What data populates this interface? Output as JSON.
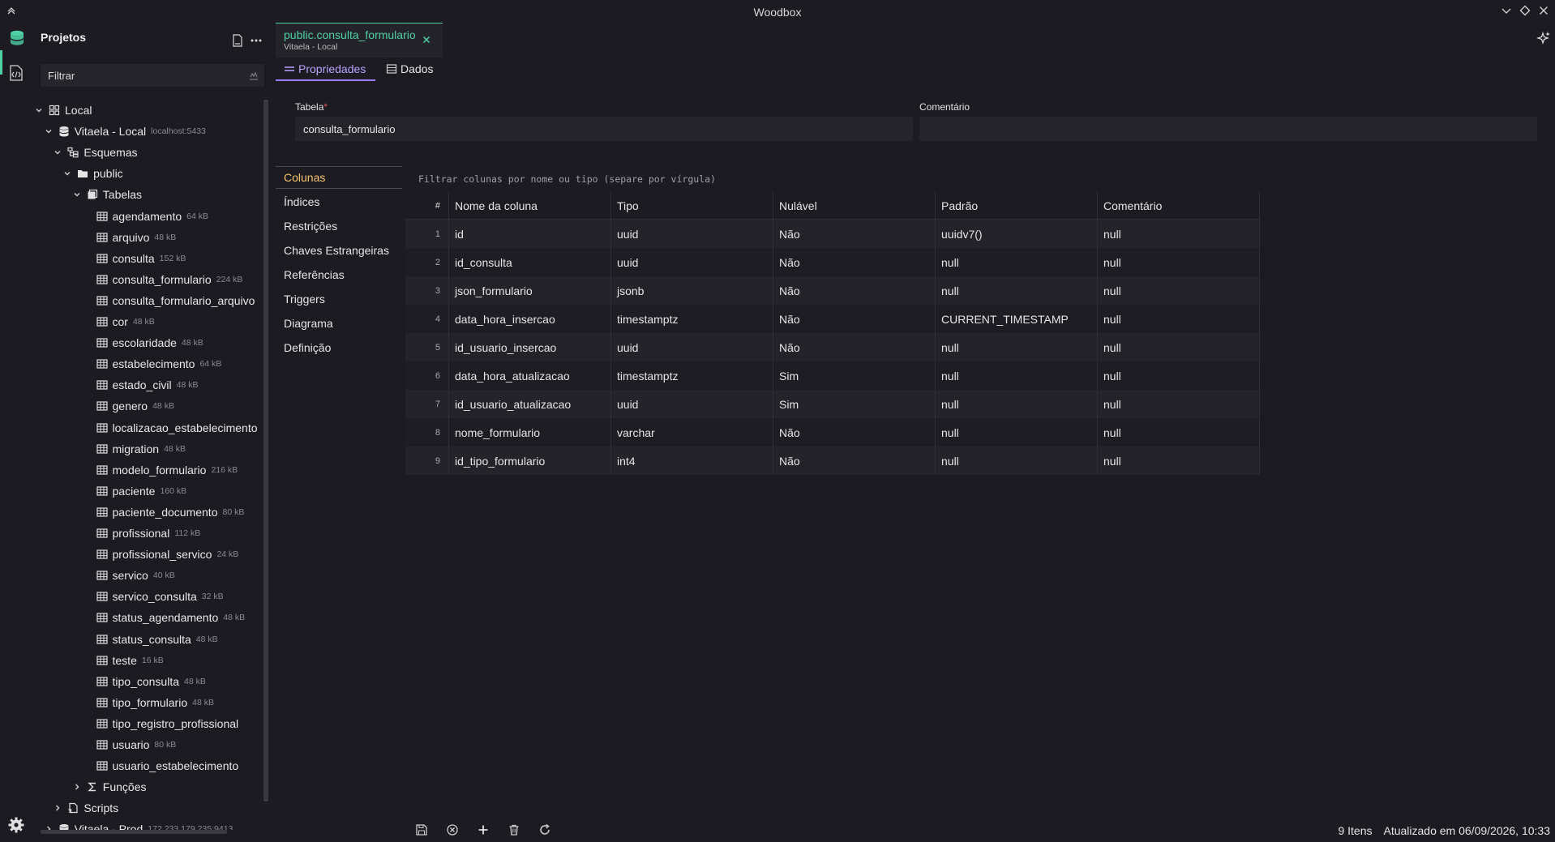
{
  "window": {
    "title": "Woodbox"
  },
  "sidebar": {
    "title": "Projetos",
    "filter_placeholder": "Filtrar",
    "tree": [
      {
        "label": "Local",
        "level": 0,
        "kind": "group",
        "expanded": true
      },
      {
        "label": "Vitaela - Local",
        "size": "localhost:5433",
        "level": 1,
        "kind": "db",
        "expanded": true
      },
      {
        "label": "Esquemas",
        "level": 2,
        "kind": "schemas",
        "expanded": true
      },
      {
        "label": "public",
        "level": 3,
        "kind": "folder",
        "expanded": true
      },
      {
        "label": "Tabelas",
        "level": 4,
        "kind": "tables",
        "expanded": true
      },
      {
        "label": "agendamento",
        "size": "64 kB",
        "level": 5,
        "kind": "table"
      },
      {
        "label": "arquivo",
        "size": "48 kB",
        "level": 5,
        "kind": "table"
      },
      {
        "label": "consulta",
        "size": "152 kB",
        "level": 5,
        "kind": "table"
      },
      {
        "label": "consulta_formulario",
        "size": "224 kB",
        "level": 5,
        "kind": "table"
      },
      {
        "label": "consulta_formulario_arquivo",
        "size": "",
        "level": 5,
        "kind": "table"
      },
      {
        "label": "cor",
        "size": "48 kB",
        "level": 5,
        "kind": "table"
      },
      {
        "label": "escolaridade",
        "size": "48 kB",
        "level": 5,
        "kind": "table"
      },
      {
        "label": "estabelecimento",
        "size": "64 kB",
        "level": 5,
        "kind": "table"
      },
      {
        "label": "estado_civil",
        "size": "48 kB",
        "level": 5,
        "kind": "table"
      },
      {
        "label": "genero",
        "size": "48 kB",
        "level": 5,
        "kind": "table"
      },
      {
        "label": "localizacao_estabelecimento",
        "size": "",
        "level": 5,
        "kind": "table"
      },
      {
        "label": "migration",
        "size": "48 kB",
        "level": 5,
        "kind": "table"
      },
      {
        "label": "modelo_formulario",
        "size": "216 kB",
        "level": 5,
        "kind": "table"
      },
      {
        "label": "paciente",
        "size": "160 kB",
        "level": 5,
        "kind": "table"
      },
      {
        "label": "paciente_documento",
        "size": "80 kB",
        "level": 5,
        "kind": "table"
      },
      {
        "label": "profissional",
        "size": "112 kB",
        "level": 5,
        "kind": "table"
      },
      {
        "label": "profissional_servico",
        "size": "24 kB",
        "level": 5,
        "kind": "table"
      },
      {
        "label": "servico",
        "size": "40 kB",
        "level": 5,
        "kind": "table"
      },
      {
        "label": "servico_consulta",
        "size": "32 kB",
        "level": 5,
        "kind": "table"
      },
      {
        "label": "status_agendamento",
        "size": "48 kB",
        "level": 5,
        "kind": "table"
      },
      {
        "label": "status_consulta",
        "size": "48 kB",
        "level": 5,
        "kind": "table"
      },
      {
        "label": "teste",
        "size": "16 kB",
        "level": 5,
        "kind": "table"
      },
      {
        "label": "tipo_consulta",
        "size": "48 kB",
        "level": 5,
        "kind": "table"
      },
      {
        "label": "tipo_formulario",
        "size": "48 kB",
        "level": 5,
        "kind": "table"
      },
      {
        "label": "tipo_registro_profissional",
        "size": "",
        "level": 5,
        "kind": "table"
      },
      {
        "label": "usuario",
        "size": "80 kB",
        "level": 5,
        "kind": "table"
      },
      {
        "label": "usuario_estabelecimento",
        "size": "",
        "level": 5,
        "kind": "table"
      },
      {
        "label": "Funções",
        "level": 4,
        "kind": "functions",
        "expanded": false
      },
      {
        "label": "Scripts",
        "level": 2,
        "kind": "scripts",
        "expanded": false
      },
      {
        "label": "Vitaela - Prod",
        "size": "172.233.179.235:9413",
        "level": 1,
        "kind": "db",
        "expanded": false
      }
    ]
  },
  "editor": {
    "tab": {
      "title": "public.consulta_formulario",
      "subtitle": "Vitaela - Local"
    },
    "subtabs": {
      "properties": "Propriedades",
      "data": "Dados"
    },
    "form": {
      "table_label": "Tabela",
      "required_mark": "*",
      "table_value": "consulta_formulario",
      "comment_label": "Comentário",
      "comment_value": ""
    },
    "nav": [
      "Colunas",
      "Índices",
      "Restrições",
      "Chaves Estrangeiras",
      "Referências",
      "Triggers",
      "Diagrama",
      "Definição"
    ],
    "column_filter_placeholder": "Filtrar colunas por nome ou tipo (separe por vírgula)",
    "grid": {
      "headers": [
        "#",
        "Nome da coluna",
        "Tipo",
        "Nulável",
        "Padrão",
        "Comentário"
      ],
      "rows": [
        [
          "1",
          "id",
          "uuid",
          "Não",
          "uuidv7()",
          "null"
        ],
        [
          "2",
          "id_consulta",
          "uuid",
          "Não",
          "null",
          "null"
        ],
        [
          "3",
          "json_formulario",
          "jsonb",
          "Não",
          "null",
          "null"
        ],
        [
          "4",
          "data_hora_insercao",
          "timestamptz",
          "Não",
          "CURRENT_TIMESTAMP",
          "null"
        ],
        [
          "5",
          "id_usuario_insercao",
          "uuid",
          "Não",
          "null",
          "null"
        ],
        [
          "6",
          "data_hora_atualizacao",
          "timestamptz",
          "Sim",
          "null",
          "null"
        ],
        [
          "7",
          "id_usuario_atualizacao",
          "uuid",
          "Sim",
          "null",
          "null"
        ],
        [
          "8",
          "nome_formulario",
          "varchar",
          "Não",
          "null",
          "null"
        ],
        [
          "9",
          "id_tipo_formulario",
          "int4",
          "Não",
          "null",
          "null"
        ]
      ]
    }
  },
  "status": {
    "count": "9 Itens",
    "updated": "Atualizado em 06/09/2026, 10:33"
  },
  "colors": {
    "accent_green": "#4fd1a5",
    "accent_purple": "#9b7bff",
    "accent_orange": "#f5c46b"
  }
}
